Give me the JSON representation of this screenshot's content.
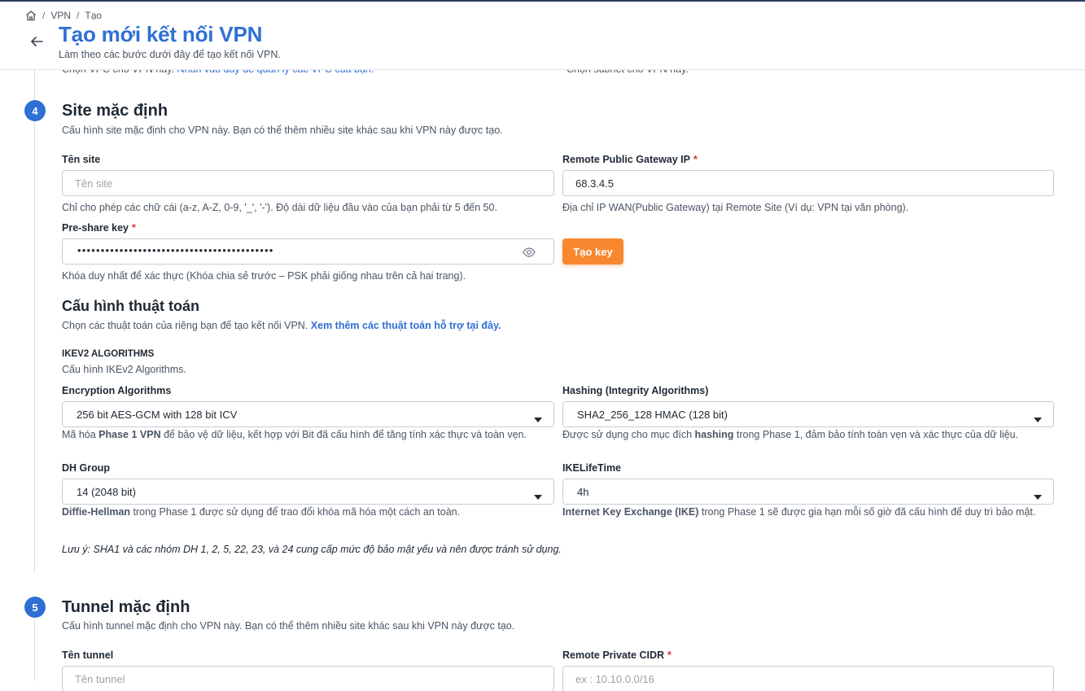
{
  "breadcrumb": {
    "home_icon": "home-icon",
    "items": [
      "VPN",
      "Tạo"
    ],
    "separator": "/"
  },
  "header": {
    "title": "Tạo mới kết nối VPN",
    "subtitle": "Làm theo các bước dưới đây để tạo kết nối VPN.",
    "back_icon": "arrow-left-icon"
  },
  "previous_row": {
    "vpc_help": "Chọn VPC cho VPN này.",
    "vpc_link": "Nhấn vào đây để quản lý các VPC của bạn.",
    "subnet_help": "Chọn subnet cho VPN này."
  },
  "colors": {
    "accent": "#2f6fd3",
    "action": "#f7882f",
    "required": "#e0342f"
  },
  "step4": {
    "number": "4",
    "title": "Site mặc định",
    "description": "Cấu hình site mặc định cho VPN này. Bạn có thể thêm nhiều site khác sau khi VPN này được tạo.",
    "site_name": {
      "label": "Tên site",
      "placeholder": "Tên site",
      "value": "",
      "help": "Chỉ cho phép các chữ cái (a-z, A-Z, 0-9, '_', '-'). Độ dài dữ liệu đầu vào của bạn phải từ 5 đến 50."
    },
    "remote_gateway": {
      "label": "Remote Public Gateway IP",
      "required_mark": "*",
      "value": "68.3.4.5",
      "help": "Địa chỉ IP WAN(Public Gateway) tại Remote Site (Ví dụ: VPN tại văn phòng)."
    },
    "preshare_key": {
      "label": "Pre-share key",
      "required_mark": "*",
      "masked_value": "••••••••••••••••••••••••••••••••••••••••••",
      "toggle_icon": "eye-icon",
      "help": "Khóa duy nhất để xác thực (Khóa chia sẻ trước – PSK phải giống nhau trên cả hai trang).",
      "generate_button": "Tạo key"
    },
    "algorithms": {
      "title": "Cấu hình thuật toán",
      "description": "Chọn các thuật toán của riêng bạn để tạo kết nối VPN.",
      "link": "Xem thêm các thuật toán hỗ trợ tại đây.",
      "ikev2_title": "IKEV2 ALGORITHMS",
      "ikev2_desc": "Cấu hình IKEv2 Algorithms.",
      "encryption": {
        "label": "Encryption Algorithms",
        "value": "256 bit AES-GCM with 128 bit ICV",
        "help_pre": "Mã hóa ",
        "help_bold": "Phase 1 VPN",
        "help_post": " để bảo vệ dữ liệu, kết hợp với Bit đã cấu hình để tăng tính xác thực và toàn vẹn."
      },
      "hashing": {
        "label": "Hashing (Integrity Algorithms)",
        "value": "SHA2_256_128 HMAC (128 bit)",
        "help_pre": "Được sử dụng cho mục đích ",
        "help_bold": "hashing",
        "help_post": " trong Phase 1, đảm bảo tính toàn vẹn và xác thực của dữ liệu."
      },
      "dh_group": {
        "label": "DH Group",
        "value": "14 (2048 bit)",
        "help_bold": "Diffie-Hellman",
        "help_post": " trong Phase 1 được sử dụng để trao đổi khóa mã hóa một cách an toàn."
      },
      "ike_lifetime": {
        "label": "IKELifeTime",
        "value": "4h",
        "help_bold": "Internet Key Exchange (IKE)",
        "help_post": " trong Phase 1 sẽ được gia hạn mỗi số giờ đã cấu hình để duy trì bảo mật."
      },
      "note": "Lưu ý: SHA1 và các nhóm DH 1, 2, 5, 22, 23, và 24 cung cấp mức độ bảo mật yếu và nên được tránh sử dụng."
    }
  },
  "step5": {
    "number": "5",
    "title": "Tunnel mặc định",
    "description": "Cấu hình tunnel mặc định cho VPN này. Bạn có thể thêm nhiều site khác sau khi VPN này được tạo.",
    "tunnel_name": {
      "label": "Tên tunnel",
      "placeholder": "Tên tunnel"
    },
    "remote_cidr": {
      "label": "Remote Private CIDR",
      "required_mark": "*",
      "placeholder": "ex : 10.10.0.0/16"
    }
  }
}
